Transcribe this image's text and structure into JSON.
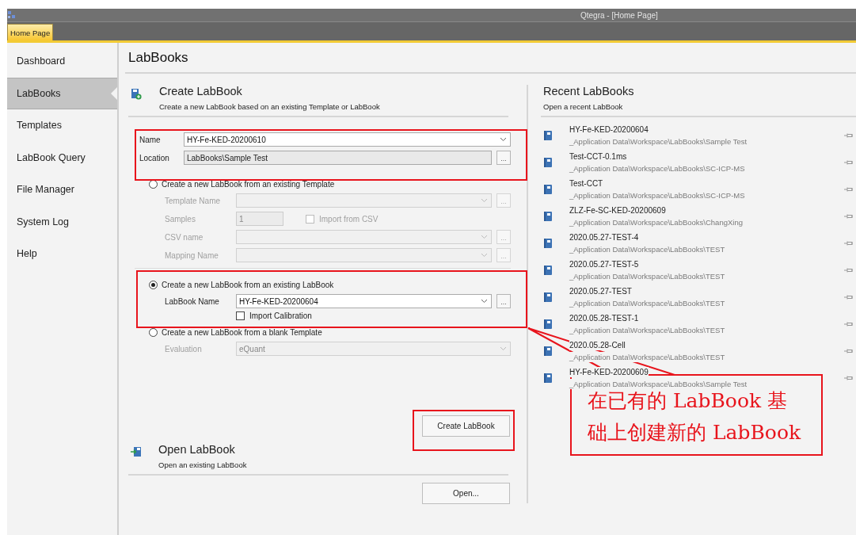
{
  "window": {
    "title": "Qtegra - [Home Page]"
  },
  "doc_tabs": [
    {
      "label": "Home Page",
      "selected": true
    }
  ],
  "sidebar": {
    "items": [
      {
        "label": "Dashboard",
        "selected": false
      },
      {
        "label": "LabBooks",
        "selected": true
      },
      {
        "label": "Templates",
        "selected": false
      },
      {
        "label": "LabBook Query",
        "selected": false
      },
      {
        "label": "File Manager",
        "selected": false
      },
      {
        "label": "System Log",
        "selected": false
      },
      {
        "label": "Help",
        "selected": false
      }
    ]
  },
  "page_title": "LabBooks",
  "create": {
    "title": "Create LabBook",
    "subtitle": "Create a new LabBook based on an existing Template or LabBook",
    "fields": [
      {
        "kind": "combo",
        "label": "Name",
        "value": "HY-Fe-KED-20200610"
      },
      {
        "kind": "readonly",
        "label": "Location",
        "value": "LabBooks\\Sample Test",
        "browse": "..."
      }
    ],
    "options": [
      {
        "label": "Create a new LabBook from an existing Template",
        "selected": false,
        "fields": [
          {
            "kind": "combo",
            "label": "Template Name",
            "browse": "..."
          },
          {
            "kind": "text",
            "label": "Samples",
            "value": "1",
            "checkbox": {
              "label": "Import from CSV",
              "checked": false
            }
          },
          {
            "kind": "combo",
            "label": "CSV name",
            "browse": "..."
          },
          {
            "kind": "combo",
            "label": "Mapping Name",
            "browse": "..."
          }
        ]
      },
      {
        "label": "Create a new LabBook from an existing LabBook",
        "selected": true,
        "fields": [
          {
            "kind": "combo",
            "label": "LabBook Name",
            "value": "HY-Fe-KED-20200604",
            "browse": "..."
          },
          {
            "kind": "checkbox",
            "label": "Import Calibration",
            "checked": false
          }
        ]
      },
      {
        "label": "Create a new LabBook from a blank Template",
        "selected": false,
        "fields": [
          {
            "kind": "combo",
            "label": "Evaluation",
            "value": "eQuant"
          }
        ]
      }
    ],
    "button": "Create LabBook"
  },
  "open": {
    "title": "Open LabBook",
    "subtitle": "Open an existing LabBook",
    "button": "Open..."
  },
  "recent": {
    "title": "Recent LabBooks",
    "subtitle": "Open a recent LabBook",
    "items": [
      {
        "name": "HY-Fe-KED-20200604",
        "path": "_Application Data\\Workspace\\LabBooks\\Sample Test"
      },
      {
        "name": "Test-CCT-0.1ms",
        "path": "_Application Data\\Workspace\\LabBooks\\SC-ICP-MS"
      },
      {
        "name": "Test-CCT",
        "path": "_Application Data\\Workspace\\LabBooks\\SC-ICP-MS"
      },
      {
        "name": "ZLZ-Fe-SC-KED-20200609",
        "path": "_Application Data\\Workspace\\LabBooks\\ChangXing"
      },
      {
        "name": "2020.05.27-TEST-4",
        "path": "_Application Data\\Workspace\\LabBooks\\TEST"
      },
      {
        "name": "2020.05.27-TEST-5",
        "path": "_Application Data\\Workspace\\LabBooks\\TEST"
      },
      {
        "name": "2020.05.27-TEST",
        "path": "_Application Data\\Workspace\\LabBooks\\TEST"
      },
      {
        "name": "2020.05.28-TEST-1",
        "path": "_Application Data\\Workspace\\LabBooks\\TEST"
      },
      {
        "name": "2020.05.28-Cell",
        "path": "_Application Data\\Workspace\\LabBooks\\TEST"
      },
      {
        "name": "HY-Fe-KED-20200609",
        "path": "_Application Data\\Workspace\\LabBooks\\Sample Test"
      }
    ]
  },
  "annotation": {
    "text": "在已有的 LabBook 基础上创建新的 LabBook"
  }
}
